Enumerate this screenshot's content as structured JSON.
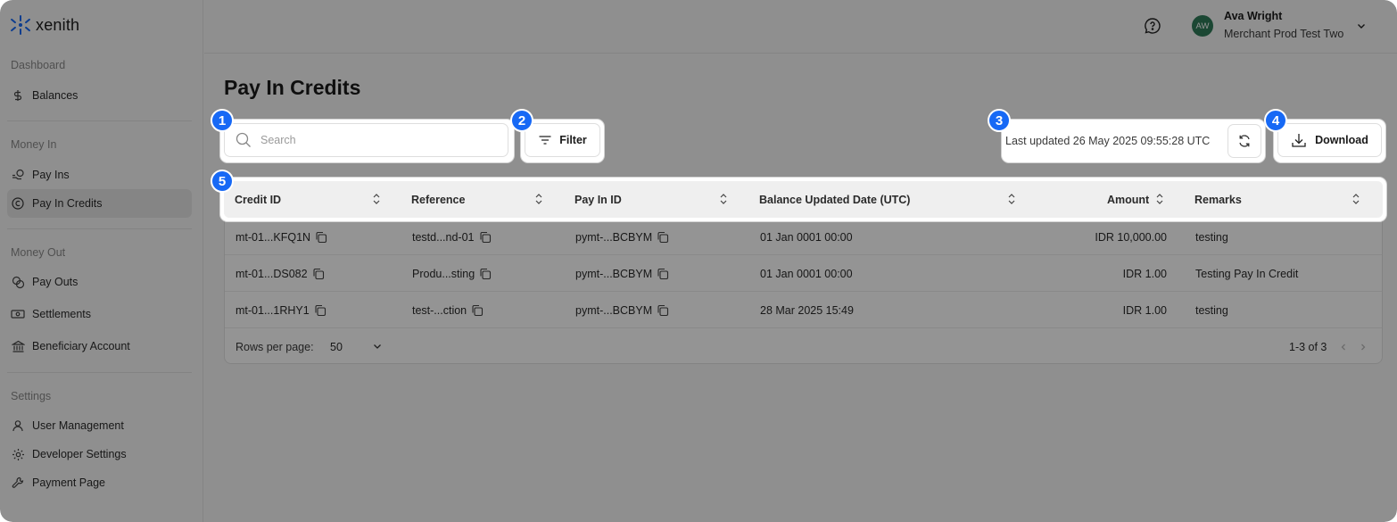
{
  "brand": {
    "name": "xenith",
    "accent": "#1769f5",
    "avatar_color": "#2f7a59"
  },
  "sidebar": {
    "sections": [
      {
        "title": "Dashboard",
        "items": [
          {
            "label": "Balances",
            "icon": "dollar-icon"
          }
        ]
      },
      {
        "title": "Money In",
        "items": [
          {
            "label": "Pay Ins",
            "icon": "pay-in-icon"
          },
          {
            "label": "Pay In Credits",
            "icon": "credit-icon",
            "active": true
          }
        ]
      },
      {
        "title": "Money Out",
        "items": [
          {
            "label": "Pay Outs",
            "icon": "coins-icon"
          },
          {
            "label": "Settlements",
            "icon": "banknote-icon"
          },
          {
            "label": "Beneficiary Account",
            "icon": "bank-icon"
          }
        ]
      },
      {
        "title": "Settings",
        "items": [
          {
            "label": "User Management",
            "icon": "user-icon"
          },
          {
            "label": "Developer Settings",
            "icon": "gear-icon"
          },
          {
            "label": "Payment Page",
            "icon": "wrench-icon"
          }
        ]
      }
    ]
  },
  "topbar": {
    "avatar_initials": "AW",
    "user_name": "Ava Wright",
    "user_org": "Merchant Prod Test Two"
  },
  "page": {
    "title": "Pay In Credits",
    "search_placeholder": "Search",
    "filter_label": "Filter",
    "last_updated": "Last updated 26 May 2025 09:55:28 UTC",
    "download_label": "Download"
  },
  "table": {
    "columns": [
      "Credit ID",
      "Reference",
      "Pay In ID",
      "Balance Updated Date (UTC)",
      "Amount",
      "Remarks"
    ],
    "rows": [
      {
        "credit_id": "mt-01...KFQ1N",
        "reference": "testd...nd-01",
        "pay_in_id": "pymt-...BCBYM",
        "date": "01 Jan 0001 00:00",
        "amount": "IDR 10,000.00",
        "remarks": "testing"
      },
      {
        "credit_id": "mt-01...DS082",
        "reference": "Produ...sting",
        "pay_in_id": "pymt-...BCBYM",
        "date": "01 Jan 0001 00:00",
        "amount": "IDR 1.00",
        "remarks": "Testing Pay In Credit"
      },
      {
        "credit_id": "mt-01...1RHY1",
        "reference": "test-...ction",
        "pay_in_id": "pymt-...BCBYM",
        "date": "28 Mar 2025 15:49",
        "amount": "IDR 1.00",
        "remarks": "testing"
      }
    ],
    "footer": {
      "rows_per_page_label": "Rows per page:",
      "rows_per_page_value": "50",
      "page_info": "1-3 of 3"
    }
  },
  "annotations": [
    "1",
    "2",
    "3",
    "4",
    "5"
  ]
}
